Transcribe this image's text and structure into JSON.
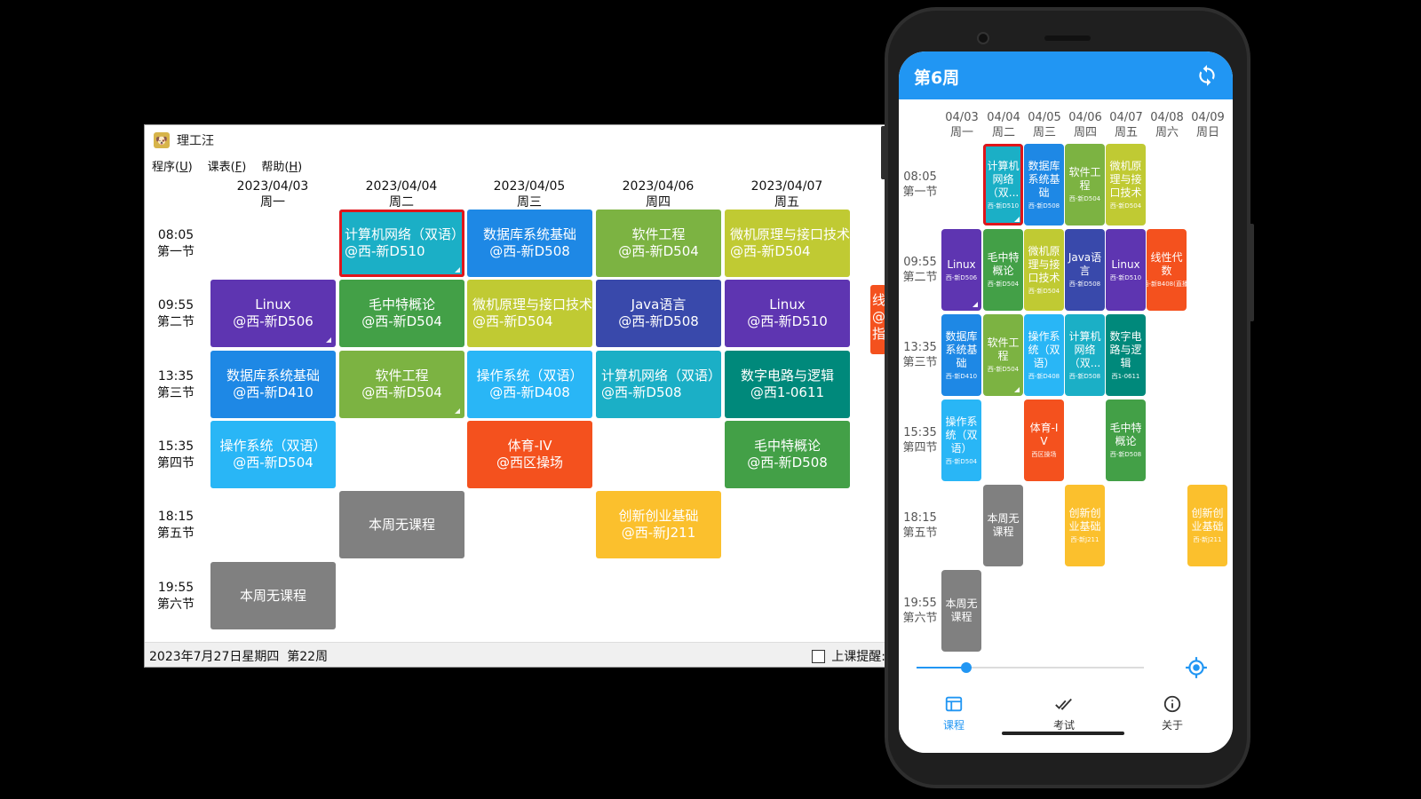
{
  "window": {
    "title": "理工汪",
    "menu": [
      {
        "label": "程序(",
        "key": "U",
        "end": ")"
      },
      {
        "label": "课表(",
        "key": "F",
        "end": ")"
      },
      {
        "label": "帮助(",
        "key": "H",
        "end": ")"
      }
    ],
    "days": [
      {
        "date": "2023/04/03",
        "week": "周一"
      },
      {
        "date": "2023/04/04",
        "week": "周二"
      },
      {
        "date": "2023/04/05",
        "week": "周三"
      },
      {
        "date": "2023/04/06",
        "week": "周四"
      },
      {
        "date": "2023/04/07",
        "week": "周五"
      }
    ],
    "times": [
      {
        "time": "08:05",
        "label": "第一节"
      },
      {
        "time": "09:55",
        "label": "第二节"
      },
      {
        "time": "13:35",
        "label": "第三节"
      },
      {
        "time": "15:35",
        "label": "第四节"
      },
      {
        "time": "18:15",
        "label": "第五节"
      },
      {
        "time": "19:55",
        "label": "第六节"
      }
    ],
    "courses": [
      {
        "day": 1,
        "slot": 0,
        "name": "计算机网络（双语）",
        "loc": "@西-新D510",
        "color": "#1bafc6",
        "selected": true,
        "corner": true
      },
      {
        "day": 2,
        "slot": 0,
        "name": "数据库系统基础",
        "loc": "@西-新D508",
        "color": "#1e88e5",
        "center": true
      },
      {
        "day": 3,
        "slot": 0,
        "name": "软件工程",
        "loc": "@西-新D504",
        "color": "#7cb342",
        "center": true
      },
      {
        "day": 4,
        "slot": 0,
        "name": "微机原理与接口技术",
        "loc": "@西-新D504",
        "color": "#c0ca33"
      },
      {
        "day": 0,
        "slot": 1,
        "name": "Linux",
        "loc": "@西-新D506",
        "color": "#5e35b1",
        "center": true,
        "corner": true
      },
      {
        "day": 1,
        "slot": 1,
        "name": "毛中特概论",
        "loc": "@西-新D504",
        "color": "#43a047",
        "center": true
      },
      {
        "day": 2,
        "slot": 1,
        "name": "微机原理与接口技术",
        "loc": "@西-新D504",
        "color": "#c0ca33"
      },
      {
        "day": 3,
        "slot": 1,
        "name": "Java语言",
        "loc": "@西-新D508",
        "color": "#3949ab",
        "center": true
      },
      {
        "day": 4,
        "slot": 1,
        "name": "Linux",
        "loc": "@西-新D510",
        "color": "#5e35b1",
        "center": true
      },
      {
        "day": 0,
        "slot": 2,
        "name": "数据库系统基础",
        "loc": "@西-新D410",
        "color": "#1e88e5",
        "center": true
      },
      {
        "day": 1,
        "slot": 2,
        "name": "软件工程",
        "loc": "@西-新D504",
        "color": "#7cb342",
        "center": true,
        "corner": true
      },
      {
        "day": 2,
        "slot": 2,
        "name": "操作系统（双语）",
        "loc": "@西-新D408",
        "color": "#29b6f6",
        "center": true
      },
      {
        "day": 3,
        "slot": 2,
        "name": "计算机网络（双语）",
        "loc": "@西-新D508",
        "color": "#1bafc6"
      },
      {
        "day": 4,
        "slot": 2,
        "name": "数字电路与逻辑",
        "loc": "@西1-0611",
        "color": "#00897b",
        "center": true
      },
      {
        "day": 0,
        "slot": 3,
        "name": "操作系统（双语）",
        "loc": "@西-新D504",
        "color": "#29b6f6",
        "center": true
      },
      {
        "day": 2,
        "slot": 3,
        "name": "体育-IV",
        "loc": "@西区操场",
        "color": "#f4511e",
        "center": true
      },
      {
        "day": 4,
        "slot": 3,
        "name": "毛中特概论",
        "loc": "@西-新D508",
        "color": "#43a047",
        "center": true
      },
      {
        "day": 1,
        "slot": 4,
        "name": "本周无课程",
        "loc": "",
        "color": "#808080",
        "center": true
      },
      {
        "day": 3,
        "slot": 4,
        "name": "创新创业基础",
        "loc": "@西-新J211",
        "color": "#fbc02d",
        "center": true
      },
      {
        "day": 0,
        "slot": 5,
        "name": "本周无课程",
        "loc": "",
        "color": "#808080",
        "center": true
      }
    ],
    "overflow_cell": {
      "name": "线",
      "loc": "@",
      "extra": "指",
      "color": "#f4511e"
    },
    "status": {
      "date_text": "2023年7月27日星期四",
      "week_text": "第22周",
      "reminder_label": "上课提醒:"
    }
  },
  "phone": {
    "title": "第6周",
    "days": [
      {
        "date": "04/03",
        "week": "周一"
      },
      {
        "date": "04/04",
        "week": "周二"
      },
      {
        "date": "04/05",
        "week": "周三"
      },
      {
        "date": "04/06",
        "week": "周四"
      },
      {
        "date": "04/07",
        "week": "周五"
      },
      {
        "date": "04/08",
        "week": "周六"
      },
      {
        "date": "04/09",
        "week": "周日"
      }
    ],
    "times": [
      {
        "time": "08:05",
        "label": "第一节"
      },
      {
        "time": "09:55",
        "label": "第二节"
      },
      {
        "time": "13:35",
        "label": "第三节"
      },
      {
        "time": "15:35",
        "label": "第四节"
      },
      {
        "time": "18:15",
        "label": "第五节"
      },
      {
        "time": "19:55",
        "label": "第六节"
      }
    ],
    "courses": [
      {
        "day": 1,
        "slot": 0,
        "name": "计算机网络（双...",
        "loc": "西-新D510",
        "color": "#1bafc6",
        "selected": true,
        "corner": true
      },
      {
        "day": 2,
        "slot": 0,
        "name": "数据库系统基础",
        "loc": "西-新D508",
        "color": "#1e88e5"
      },
      {
        "day": 3,
        "slot": 0,
        "name": "软件工程",
        "loc": "西-新D504",
        "color": "#7cb342"
      },
      {
        "day": 4,
        "slot": 0,
        "name": "微机原理与接口技术",
        "loc": "西-新D504",
        "color": "#c0ca33"
      },
      {
        "day": 0,
        "slot": 1,
        "name": "Linux",
        "loc": "西-新D506",
        "color": "#5e35b1",
        "corner": true
      },
      {
        "day": 1,
        "slot": 1,
        "name": "毛中特概论",
        "loc": "西-新D504",
        "color": "#43a047"
      },
      {
        "day": 2,
        "slot": 1,
        "name": "微机原理与接口技术",
        "loc": "西-新D504",
        "color": "#c0ca33"
      },
      {
        "day": 3,
        "slot": 1,
        "name": "Java语言",
        "loc": "西-新D508",
        "color": "#3949ab"
      },
      {
        "day": 4,
        "slot": 1,
        "name": "Linux",
        "loc": "西-新D510",
        "color": "#5e35b1"
      },
      {
        "day": 5,
        "slot": 1,
        "name": "线性代数",
        "loc": "西-新B408(直播)",
        "color": "#f4511e"
      },
      {
        "day": 0,
        "slot": 2,
        "name": "数据库系统基础",
        "loc": "西-新D410",
        "color": "#1e88e5"
      },
      {
        "day": 1,
        "slot": 2,
        "name": "软件工程",
        "loc": "西-新D504",
        "color": "#7cb342",
        "corner": true
      },
      {
        "day": 2,
        "slot": 2,
        "name": "操作系统（双语）",
        "loc": "西-新D408",
        "color": "#29b6f6"
      },
      {
        "day": 3,
        "slot": 2,
        "name": "计算机网络（双...",
        "loc": "西-新D508",
        "color": "#1bafc6"
      },
      {
        "day": 4,
        "slot": 2,
        "name": "数字电路与逻辑",
        "loc": "西1-0611",
        "color": "#00897b"
      },
      {
        "day": 0,
        "slot": 3,
        "name": "操作系统（双语）",
        "loc": "西-新D504",
        "color": "#29b6f6"
      },
      {
        "day": 2,
        "slot": 3,
        "name": "体育-IV",
        "loc": "西区操场",
        "color": "#f4511e"
      },
      {
        "day": 4,
        "slot": 3,
        "name": "毛中特概论",
        "loc": "西-新D508",
        "color": "#43a047"
      },
      {
        "day": 1,
        "slot": 4,
        "name": "本周无课程",
        "loc": "",
        "color": "#808080"
      },
      {
        "day": 3,
        "slot": 4,
        "name": "创新创业基础",
        "loc": "西-新J211",
        "color": "#fbc02d"
      },
      {
        "day": 6,
        "slot": 4,
        "name": "创新创业基础",
        "loc": "西-新J211",
        "color": "#fbc02d"
      },
      {
        "day": 0,
        "slot": 5,
        "name": "本周无课程",
        "loc": "",
        "color": "#808080"
      }
    ],
    "week_progress": 0.22,
    "nav": [
      {
        "label": "课程",
        "icon": "timetable-icon",
        "active": true
      },
      {
        "label": "考试",
        "icon": "double-check-icon",
        "active": false
      },
      {
        "label": "关于",
        "icon": "info-icon",
        "active": false
      }
    ],
    "accent": "#2196f3"
  }
}
